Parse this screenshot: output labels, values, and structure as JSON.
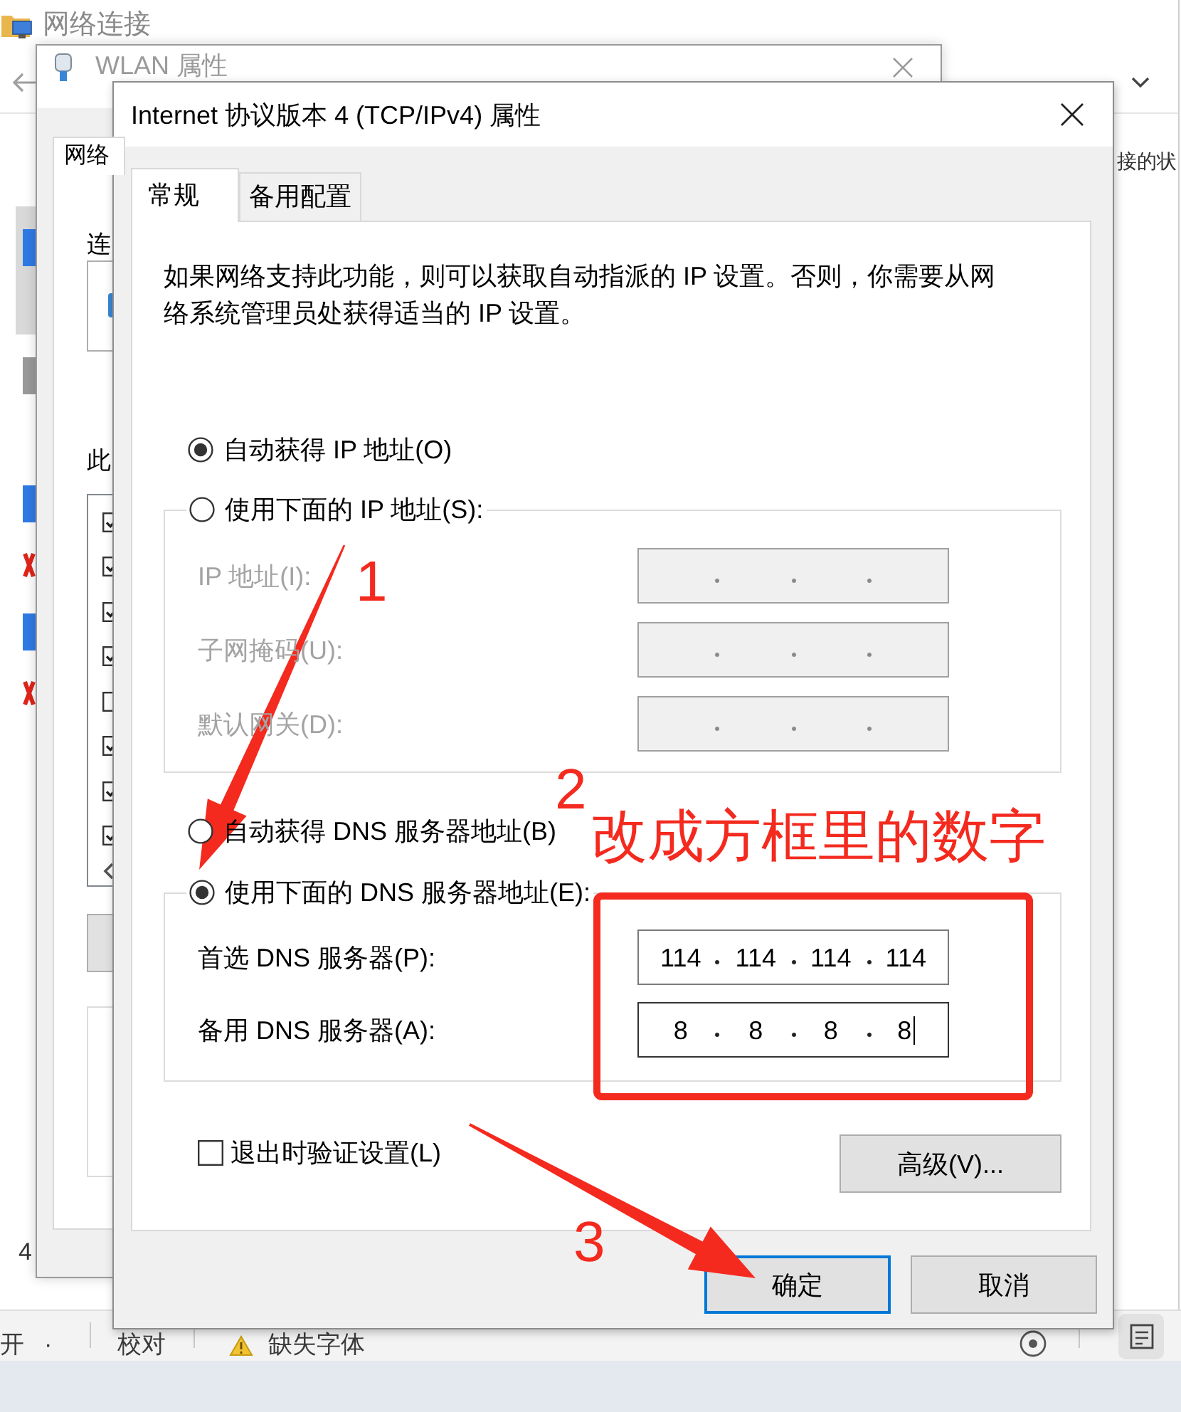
{
  "explorer_window": {
    "title": "网络连接",
    "command_bar_text": "接的状",
    "item_count": "4",
    "adapters": [
      {
        "selected": true,
        "disabled": false,
        "disconnected": false
      },
      {
        "selected": false,
        "disabled": true,
        "disconnected": false
      },
      {
        "selected": false,
        "disabled": false,
        "disconnected": true
      },
      {
        "selected": false,
        "disabled": false,
        "disconnected": true
      }
    ]
  },
  "status_bar": {
    "left_text": "开",
    "dot": "·",
    "proofing": "校对",
    "font_warning": "缺失字体"
  },
  "wlan_window": {
    "title": "WLAN 属性",
    "tabs": [
      {
        "label": "网络",
        "selected": true
      }
    ],
    "connect_label": "连",
    "components_label": "此",
    "components": [
      {
        "checked": true
      },
      {
        "checked": true
      },
      {
        "checked": true
      },
      {
        "checked": true
      },
      {
        "checked": false
      },
      {
        "checked": true
      },
      {
        "checked": true
      },
      {
        "checked": true
      }
    ]
  },
  "dialog": {
    "title": "Internet 协议版本 4 (TCP/IPv4) 属性",
    "tabs": [
      {
        "label": "常规",
        "selected": true
      },
      {
        "label": "备用配置",
        "selected": false
      }
    ],
    "description": "如果网络支持此功能，则可以获取自动指派的 IP 设置。否则，你需要从网络系统管理员处获得适当的 IP 设置。",
    "ip_options": [
      {
        "label": "自动获得 IP 地址(O)",
        "selected": true
      },
      {
        "label": "使用下面的 IP 地址(S):",
        "selected": false
      }
    ],
    "ip_fields": {
      "disabled": true,
      "fields": [
        {
          "label": "IP 地址(I):"
        },
        {
          "label": "子网掩码(U):"
        },
        {
          "label": "默认网关(D):"
        }
      ]
    },
    "dns_options": [
      {
        "label": "自动获得 DNS 服务器地址(B)",
        "selected": false
      },
      {
        "label": "使用下面的 DNS 服务器地址(E):",
        "selected": true
      }
    ],
    "dns_fields": {
      "disabled": false,
      "fields": [
        {
          "label": "首选 DNS 服务器(P):",
          "octets": [
            "114",
            "114",
            "114",
            "114"
          ],
          "focused": false
        },
        {
          "label": "备用 DNS 服务器(A):",
          "octets": [
            "8",
            "8",
            "8",
            "8"
          ],
          "focused": true
        }
      ]
    },
    "verify_on_exit": {
      "label": "退出时验证设置(L)",
      "checked": false
    },
    "advanced_button": "高级(V)...",
    "buttons": [
      {
        "label": "确定",
        "default": true
      },
      {
        "label": "取消",
        "default": false
      }
    ]
  },
  "annotations": {
    "steps": [
      "1",
      "2",
      "3"
    ],
    "note": "改成方框里的数字"
  }
}
